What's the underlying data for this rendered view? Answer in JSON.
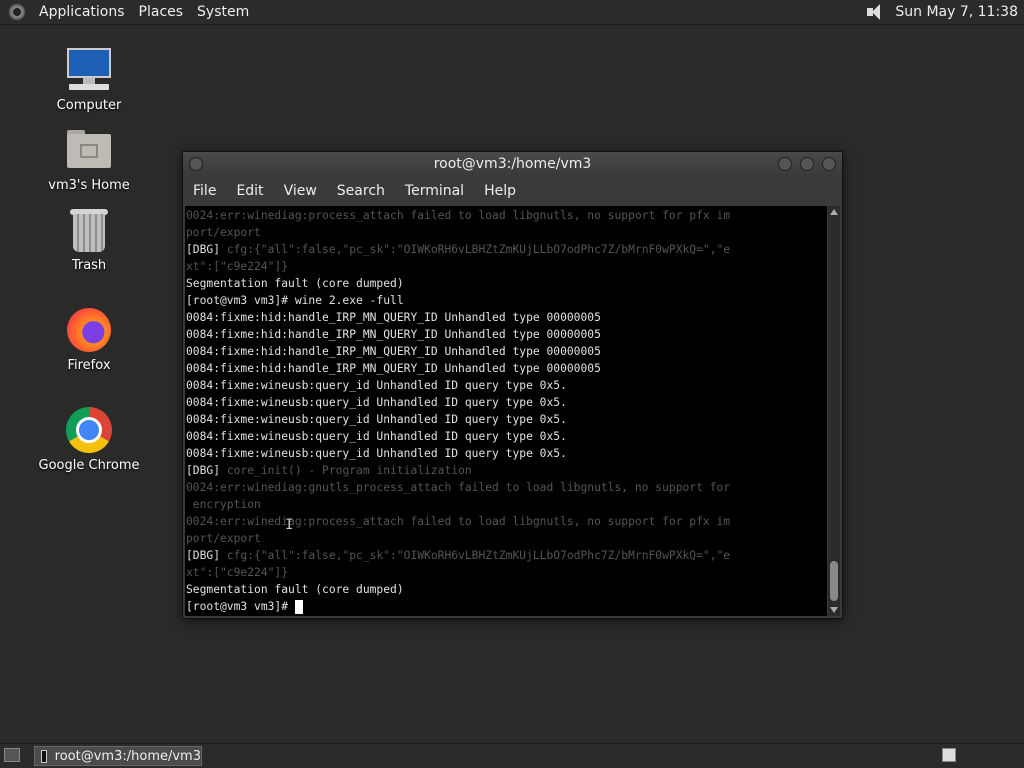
{
  "top_panel": {
    "menus": [
      "Applications",
      "Places",
      "System"
    ],
    "clock": "Sun May  7, 11:38",
    "volume_icon": "volume-icon"
  },
  "desktop_icons": [
    {
      "label": "Computer",
      "icon": "computer-icon"
    },
    {
      "label": "vm3's Home",
      "icon": "home-folder-icon"
    },
    {
      "label": "Trash",
      "icon": "trash-icon"
    },
    {
      "label": "Firefox",
      "icon": "firefox-icon"
    },
    {
      "label": "Google Chrome",
      "icon": "chrome-icon"
    }
  ],
  "terminal": {
    "title": "root@vm3:/home/vm3",
    "menu": [
      "File",
      "Edit",
      "View",
      "Search",
      "Terminal",
      "Help"
    ],
    "lines": [
      {
        "text": "0024:err:winediag:process_attach failed to load libgnutls, no support for pfx im",
        "style": "dim"
      },
      {
        "text": "port/export",
        "style": "dim"
      },
      {
        "text": "[DBG] cfg:{\"all\":false,\"pc_sk\":\"OIWKoRH6vLBHZtZmKUjLLbO7odPhc7Z/bMrnF0wPXkQ=\",\"e",
        "style": "mixed"
      },
      {
        "text": "xt\":[\"c9e224\"]}",
        "style": "dim"
      },
      {
        "text": "Segmentation fault (core dumped)",
        "style": "norm"
      },
      {
        "text": "[root@vm3 vm3]# wine 2.exe -full",
        "style": "norm"
      },
      {
        "text": "0084:fixme:hid:handle_IRP_MN_QUERY_ID Unhandled type 00000005",
        "style": "norm"
      },
      {
        "text": "0084:fixme:hid:handle_IRP_MN_QUERY_ID Unhandled type 00000005",
        "style": "norm"
      },
      {
        "text": "0084:fixme:hid:handle_IRP_MN_QUERY_ID Unhandled type 00000005",
        "style": "norm"
      },
      {
        "text": "0084:fixme:hid:handle_IRP_MN_QUERY_ID Unhandled type 00000005",
        "style": "norm"
      },
      {
        "text": "0084:fixme:wineusb:query_id Unhandled ID query type 0x5.",
        "style": "norm"
      },
      {
        "text": "0084:fixme:wineusb:query_id Unhandled ID query type 0x5.",
        "style": "norm"
      },
      {
        "text": "0084:fixme:wineusb:query_id Unhandled ID query type 0x5.",
        "style": "norm"
      },
      {
        "text": "0084:fixme:wineusb:query_id Unhandled ID query type 0x5.",
        "style": "norm"
      },
      {
        "text": "0084:fixme:wineusb:query_id Unhandled ID query type 0x5.",
        "style": "norm"
      },
      {
        "text": "[DBG] core_init() - Program initialization",
        "style": "mixed"
      },
      {
        "text": "0024:err:winediag:gnutls_process_attach failed to load libgnutls, no support for",
        "style": "dim"
      },
      {
        "text": " encryption",
        "style": "dim"
      },
      {
        "text": "0024:err:winediag:process_attach failed to load libgnutls, no support for pfx im",
        "style": "dim"
      },
      {
        "text": "port/export",
        "style": "dim"
      },
      {
        "text": "[DBG] cfg:{\"all\":false,\"pc_sk\":\"OIWKoRH6vLBHZtZmKUjLLbO7odPhc7Z/bMrnF0wPXkQ=\",\"e",
        "style": "mixed"
      },
      {
        "text": "xt\":[\"c9e224\"]}",
        "style": "dim"
      },
      {
        "text": "Segmentation fault (core dumped)",
        "style": "norm"
      },
      {
        "text": "[root@vm3 vm3]# ",
        "style": "prompt"
      }
    ]
  },
  "bottom_panel": {
    "task_label": "root@vm3:/home/vm3"
  }
}
